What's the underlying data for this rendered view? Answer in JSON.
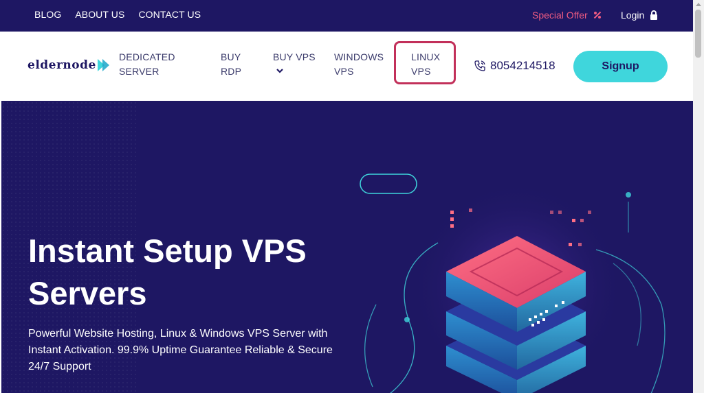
{
  "topbar": {
    "links": [
      "BLOG",
      "ABOUT US",
      "CONTACT US"
    ],
    "special_offer": "Special Offer",
    "login": "Login"
  },
  "logo": {
    "text": "eldernode"
  },
  "nav": {
    "dedicated_server": [
      "DEDICATED",
      "SERVER"
    ],
    "buy_rdp": [
      "BUY",
      "RDP"
    ],
    "buy_vps": "BUY VPS",
    "windows_vps": [
      "WINDOWS",
      "VPS"
    ],
    "linux_vps": [
      "LINUX",
      "VPS"
    ]
  },
  "phone": "8054214518",
  "signup": "Signup",
  "hero": {
    "title": "Instant Setup VPS Servers",
    "description": "Powerful Website Hosting, Linux & Windows VPS Server with Instant Activation. 99.9% Uptime Guarantee Reliable & Secure 24/7 Support"
  },
  "colors": {
    "navy": "#1e1763",
    "accent_cyan": "#3fd6dc",
    "offer_pink": "#ef5b82",
    "highlight_red": "#c2305a"
  }
}
